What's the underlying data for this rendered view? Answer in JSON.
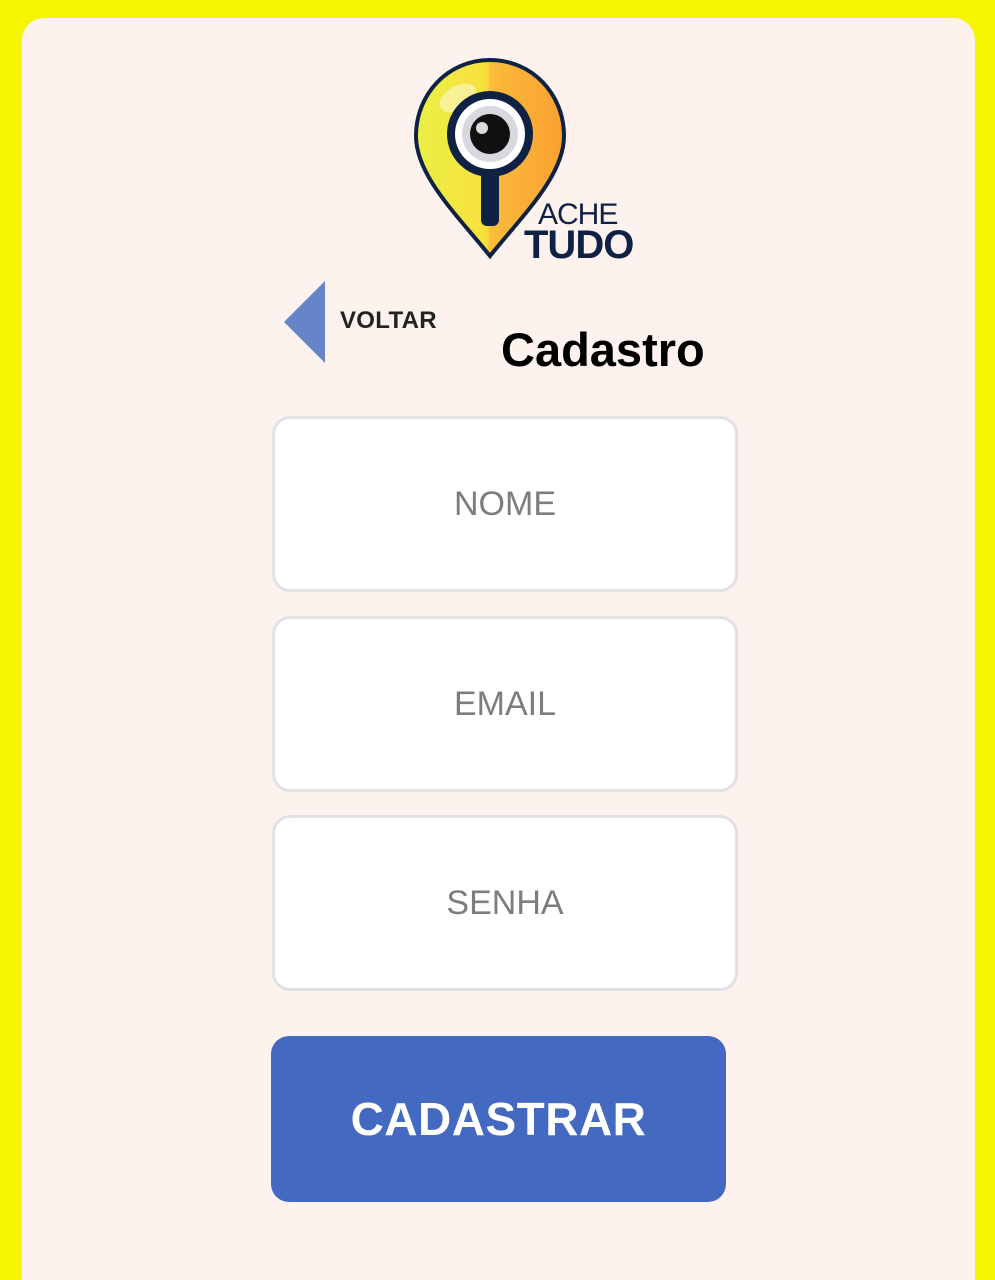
{
  "logo": {
    "line1": "ACHE",
    "line2": "TUDO"
  },
  "nav": {
    "back_label": "VOLTAR"
  },
  "page": {
    "title": "Cadastro"
  },
  "form": {
    "nome_placeholder": "NOME",
    "email_placeholder": "EMAIL",
    "senha_placeholder": "SENHA",
    "submit_label": "CADASTRAR"
  },
  "colors": {
    "frame": "#f5f500",
    "background": "#fdf2ee",
    "accent": "#4469c0",
    "back_arrow": "#6684c8",
    "logo_navy": "#0f2244",
    "logo_yellow": "#f7e83a",
    "logo_orange": "#f9a634"
  }
}
